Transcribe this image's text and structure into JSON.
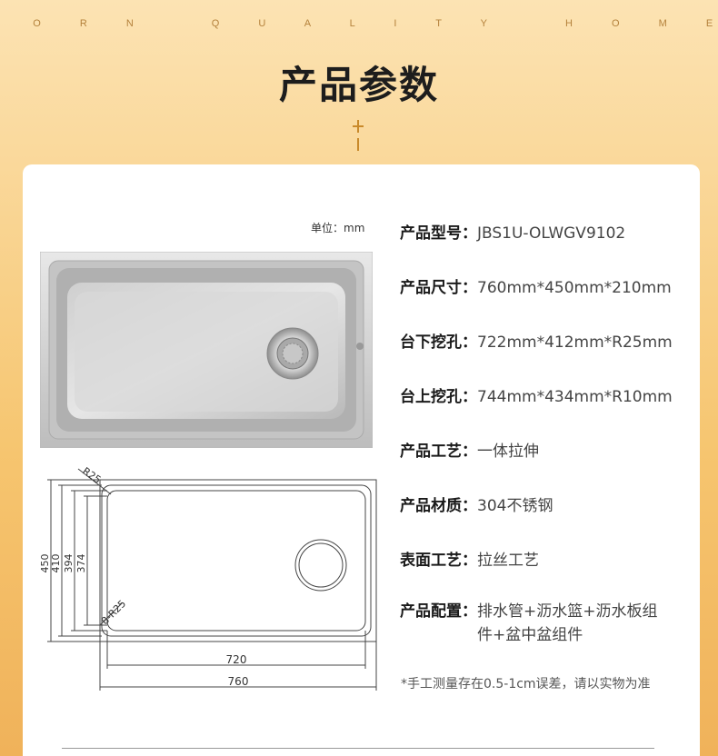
{
  "tagline": [
    "B O R N",
    "Q U A L I T Y",
    "H O M E"
  ],
  "title": "产品参数",
  "unit_note": "单位：mm",
  "specs": [
    {
      "label": "产品型号：",
      "value": "JBS1U-OLWGV9102"
    },
    {
      "label": "产品尺寸：",
      "value": "760mm*450mm*210mm"
    },
    {
      "label": "台下挖孔：",
      "value": "722mm*412mm*R25mm"
    },
    {
      "label": "台上挖孔：",
      "value": "744mm*434mm*R10mm"
    },
    {
      "label": "产品工艺：",
      "value": "一体拉伸"
    },
    {
      "label": "产品材质：",
      "value": "304不锈钢"
    },
    {
      "label": "表面工艺：",
      "value": "拉丝工艺"
    },
    {
      "label": "产品配置：",
      "value": "排水管+沥水篮+沥水板组件+盆中盆组件"
    }
  ],
  "footnote": "*手工测量存在0.5-1cm误差，请以实物为准",
  "drawing": {
    "corner_radius": "R25",
    "inner_radius": "8-R25",
    "heights": [
      "450",
      "410",
      "394",
      "374"
    ],
    "width_inner": "720",
    "width_outer": "760"
  }
}
